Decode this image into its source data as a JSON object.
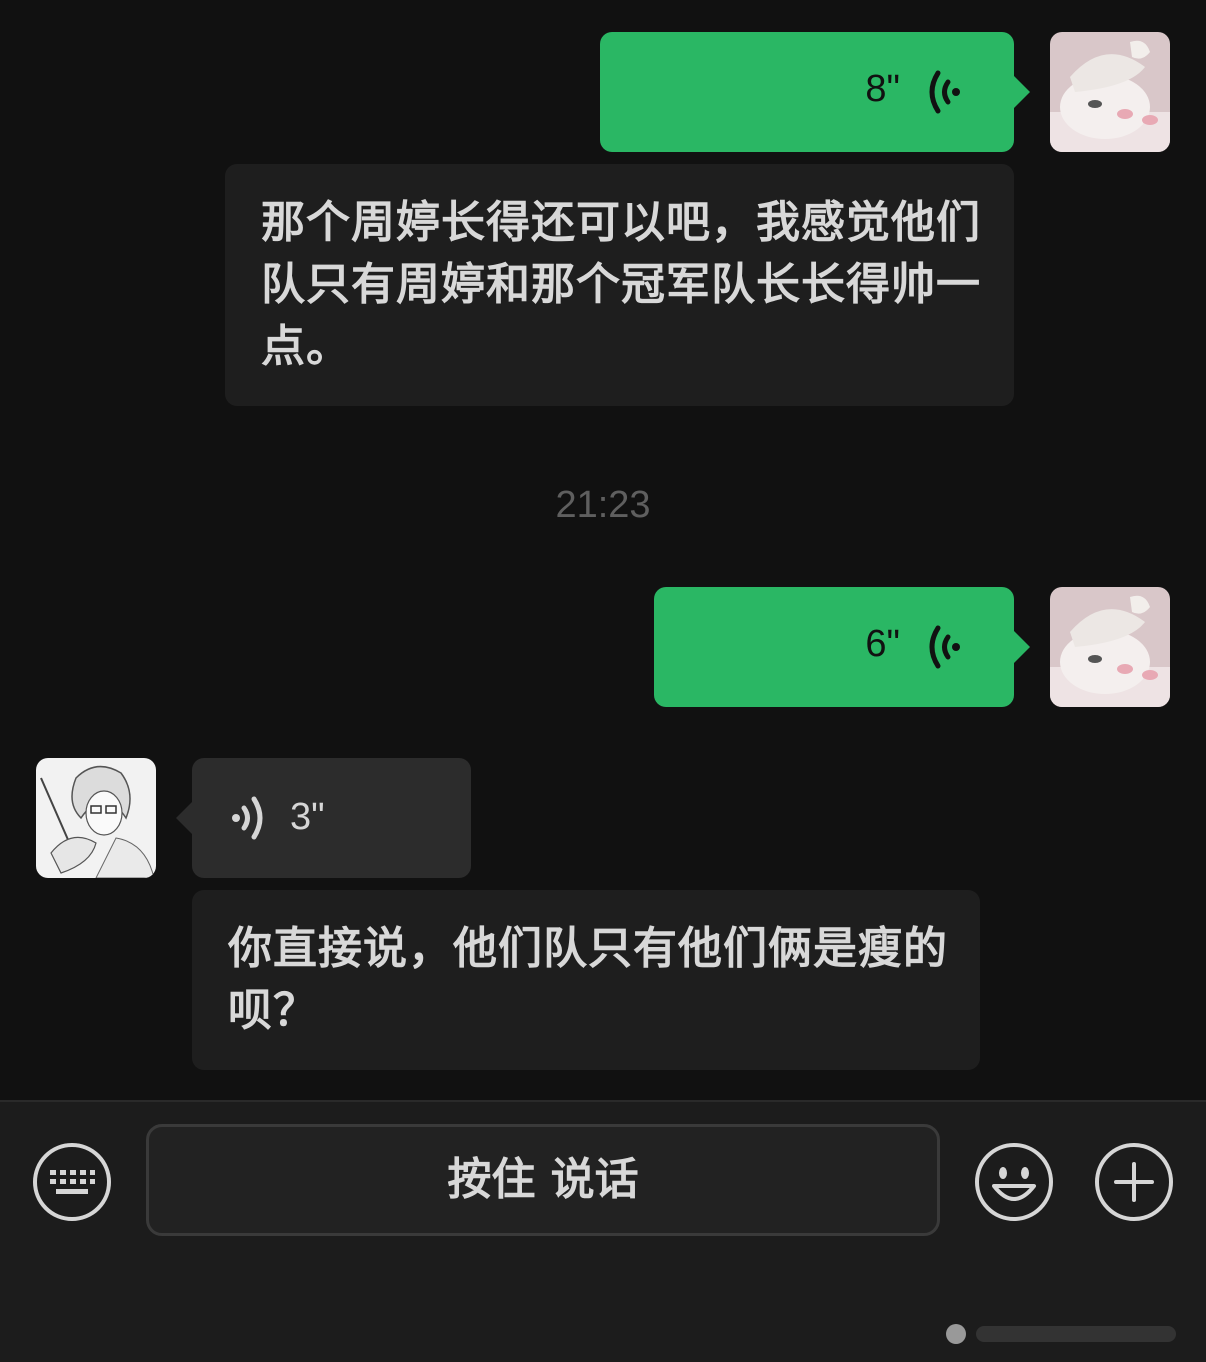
{
  "messages": {
    "voice1": {
      "duration": "8\""
    },
    "text1": {
      "content": "那个周婷长得还可以吧，我感觉他们队只有周婷和那个冠军队长长得帅一点。"
    },
    "timestamp": "21:23",
    "voice2": {
      "duration": "6\""
    },
    "voice3": {
      "duration": "3\""
    },
    "text2": {
      "content": "你直接说，他们队只有他们俩是瘦的呗？"
    }
  },
  "toolbar": {
    "hold_to_talk_label": "按住 说话",
    "keyboard_icon": "keyboard-icon",
    "emoji_icon": "emoji-icon",
    "plus_icon": "plus-icon"
  },
  "colors": {
    "background": "#111111",
    "sent_bubble": "#2ab764",
    "received_bubble": "#2c2c2c",
    "text": "#d8d8d8",
    "timestamp": "#5f5f5f"
  }
}
